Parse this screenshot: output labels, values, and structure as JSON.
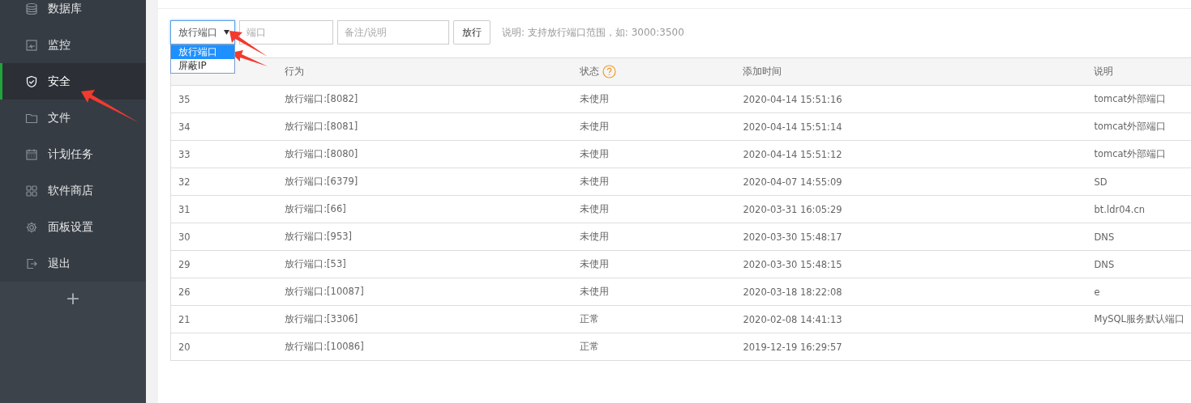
{
  "sidebar": {
    "items": [
      {
        "label": "数据库",
        "selected": false
      },
      {
        "label": "监控",
        "selected": false
      },
      {
        "label": "安全",
        "selected": true
      },
      {
        "label": "文件",
        "selected": false
      },
      {
        "label": "计划任务",
        "selected": false
      },
      {
        "label": "软件商店",
        "selected": false
      },
      {
        "label": "面板设置",
        "selected": false
      },
      {
        "label": "退出",
        "selected": false
      }
    ],
    "add_button": "+"
  },
  "toolbar": {
    "type_select": {
      "value": "放行端口",
      "expanded": true,
      "options": [
        {
          "label": "放行端口",
          "selected": true
        },
        {
          "label": "屏蔽IP",
          "selected": false
        }
      ]
    },
    "port_field": {
      "placeholder": "端口"
    },
    "note_field": {
      "placeholder": "备注/说明"
    },
    "submit_button": "放行",
    "hint": "说明: 支持放行端口范围，如: 3000:3500"
  },
  "table": {
    "columns": [
      "",
      "行为",
      "状态",
      "添加时间",
      "说明"
    ],
    "rows": [
      {
        "id": "35",
        "action": "放行端口:[8082]",
        "status": "未使用",
        "time": "2020-04-14 15:51:16",
        "note": "tomcat外部端口"
      },
      {
        "id": "34",
        "action": "放行端口:[8081]",
        "status": "未使用",
        "time": "2020-04-14 15:51:14",
        "note": "tomcat外部端口"
      },
      {
        "id": "33",
        "action": "放行端口:[8080]",
        "status": "未使用",
        "time": "2020-04-14 15:51:12",
        "note": "tomcat外部端口"
      },
      {
        "id": "32",
        "action": "放行端口:[6379]",
        "status": "未使用",
        "time": "2020-04-07 14:55:09",
        "note": "SD"
      },
      {
        "id": "31",
        "action": "放行端口:[66]",
        "status": "未使用",
        "time": "2020-03-31 16:05:29",
        "note": "bt.ldr04.cn"
      },
      {
        "id": "30",
        "action": "放行端口:[953]",
        "status": "未使用",
        "time": "2020-03-30 15:48:17",
        "note": "DNS"
      },
      {
        "id": "29",
        "action": "放行端口:[53]",
        "status": "未使用",
        "time": "2020-03-30 15:48:15",
        "note": "DNS"
      },
      {
        "id": "26",
        "action": "放行端口:[10087]",
        "status": "未使用",
        "time": "2020-03-18 18:22:08",
        "note": "e"
      },
      {
        "id": "21",
        "action": "放行端口:[3306]",
        "status": "正常",
        "time": "2020-02-08 14:41:13",
        "note": "MySQL服务默认端口"
      },
      {
        "id": "20",
        "action": "放行端口:[10086]",
        "status": "正常",
        "time": "2019-12-19 16:29:57"
      }
    ]
  }
}
